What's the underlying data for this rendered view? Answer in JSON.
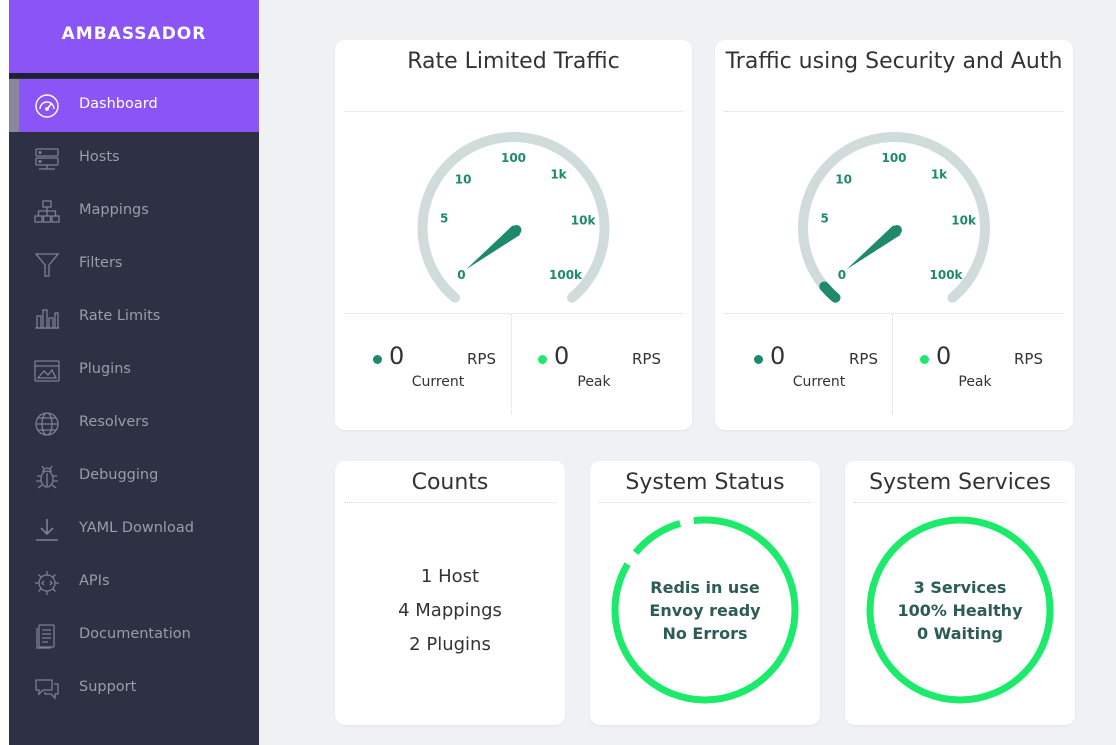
{
  "brand": {
    "logo_text": "AMBASSADOR"
  },
  "colors": {
    "brand_purple": "#8a54f7",
    "sidebar_bg": "#2d3143",
    "gauge_track": "#cfdcd9",
    "gauge_needle": "#1e8a6b",
    "status_green": "#1bea6a",
    "dot_current": "#1e8a6b",
    "dot_peak": "#1bea6a"
  },
  "sidebar": {
    "items": [
      {
        "label": "Dashboard",
        "icon": "speedometer-icon",
        "active": true
      },
      {
        "label": "Hosts",
        "icon": "server-icon"
      },
      {
        "label": "Mappings",
        "icon": "sitemap-icon"
      },
      {
        "label": "Filters",
        "icon": "filter-icon"
      },
      {
        "label": "Rate Limits",
        "icon": "bar-chart-icon"
      },
      {
        "label": "Plugins",
        "icon": "plugin-window-icon"
      },
      {
        "label": "Resolvers",
        "icon": "globe-icon"
      },
      {
        "label": "Debugging",
        "icon": "bug-icon"
      },
      {
        "label": "YAML Download",
        "icon": "download-icon"
      },
      {
        "label": "APIs",
        "icon": "api-gear-icon"
      },
      {
        "label": "Documentation",
        "icon": "document-icon"
      },
      {
        "label": "Support",
        "icon": "chat-icon"
      }
    ]
  },
  "gauges": [
    {
      "title": "Rate Limited Traffic",
      "scale_labels": [
        "0",
        "5",
        "10",
        "100",
        "1k",
        "10k",
        "100k"
      ],
      "value": 0,
      "current": {
        "value": "0",
        "unit": "RPS",
        "label": "Current"
      },
      "peak": {
        "value": "0",
        "unit": "RPS",
        "label": "Peak"
      }
    },
    {
      "title": "Traffic using Security and Auth",
      "scale_labels": [
        "0",
        "5",
        "10",
        "100",
        "1k",
        "10k",
        "100k"
      ],
      "value": 0,
      "current": {
        "value": "0",
        "unit": "RPS",
        "label": "Current"
      },
      "peak": {
        "value": "0",
        "unit": "RPS",
        "label": "Peak"
      }
    }
  ],
  "counts": {
    "title": "Counts",
    "lines": [
      "1 Host",
      "4 Mappings",
      "2 Plugins"
    ]
  },
  "system_status": {
    "title": "System Status",
    "lines": [
      "Redis in use",
      "Envoy ready",
      "No Errors"
    ]
  },
  "system_services": {
    "title": "System Services",
    "lines": [
      "3 Services",
      "100% Healthy",
      "0 Waiting"
    ]
  }
}
